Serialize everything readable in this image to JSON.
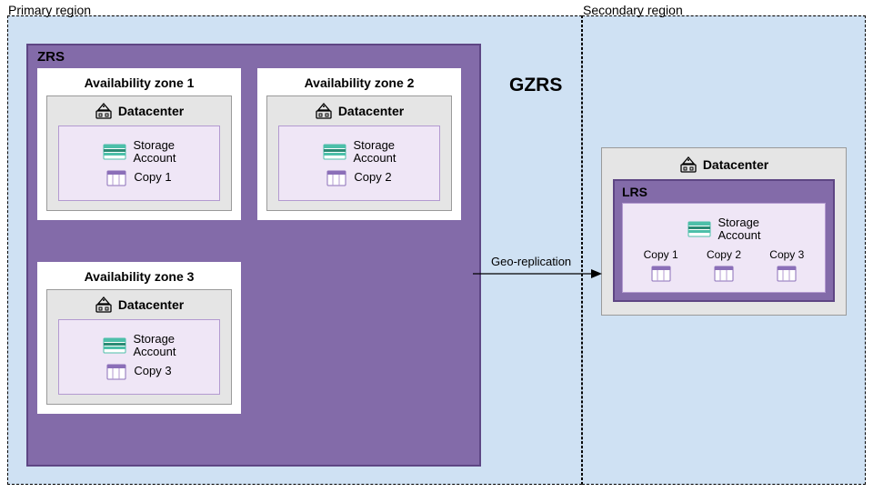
{
  "title": "GZRS",
  "primary": {
    "label": "Primary region",
    "zrs_label": "ZRS",
    "zones": [
      {
        "title": "Availability zone 1",
        "dc": "Datacenter",
        "storage": "Storage\nAccount",
        "copy": "Copy 1"
      },
      {
        "title": "Availability zone 2",
        "dc": "Datacenter",
        "storage": "Storage\nAccount",
        "copy": "Copy 2"
      },
      {
        "title": "Availability zone 3",
        "dc": "Datacenter",
        "storage": "Storage\nAccount",
        "copy": "Copy 3"
      }
    ]
  },
  "secondary": {
    "label": "Secondary region",
    "dc": "Datacenter",
    "lrs_label": "LRS",
    "storage": "Storage\nAccount",
    "copies": [
      "Copy 1",
      "Copy 2",
      "Copy 3"
    ]
  },
  "replication_label": "Geo-replication"
}
